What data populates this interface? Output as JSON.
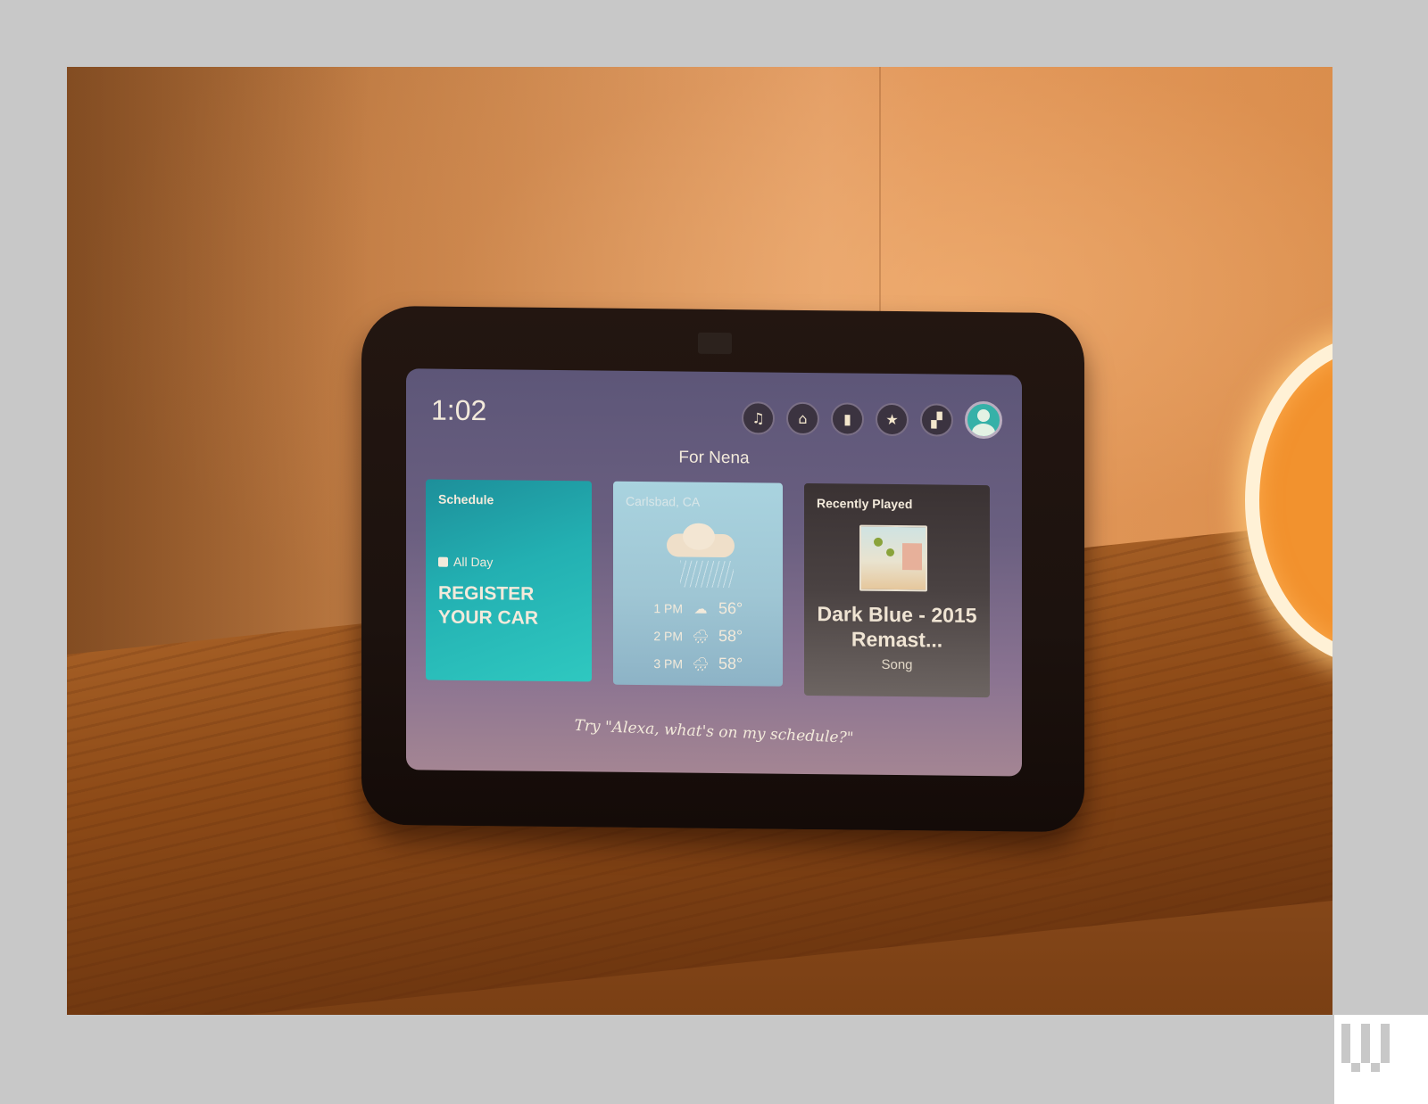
{
  "scene": {
    "description": "Photo of an Amazon Echo Show smart display on a wooden table",
    "colors": {
      "page_background": "#c8c8c8",
      "screen_top": "#5d5678",
      "screen_bottom": "#a48593",
      "schedule_card": "#23b0b2",
      "weather_card": "#a9d3df",
      "music_card": "#3a3233",
      "text_light": "#f3eadb"
    }
  },
  "screen": {
    "clock": "1:02",
    "header_icons": [
      {
        "name": "music-icon",
        "glyph": "♫"
      },
      {
        "name": "smart-home-icon",
        "glyph": "⌂"
      },
      {
        "name": "shopping-bag-icon",
        "glyph": "▮"
      },
      {
        "name": "favorites-star-icon",
        "glyph": "★"
      },
      {
        "name": "add-widget-icon",
        "glyph": "▞"
      }
    ],
    "profile_avatar": "user-avatar",
    "for_label": "For Nena",
    "cards": {
      "schedule": {
        "title": "Schedule",
        "when": "All Day",
        "event": "REGISTER YOUR CAR"
      },
      "weather": {
        "location": "Carlsbad, CA",
        "current_condition": "rain",
        "hourly": [
          {
            "time": "1 PM",
            "icon": "☁",
            "condition": "cloudy",
            "temp": "56°"
          },
          {
            "time": "2 PM",
            "icon": "🌧",
            "condition": "rain",
            "temp": "58°"
          },
          {
            "time": "3 PM",
            "icon": "🌧",
            "condition": "rain",
            "temp": "58°"
          }
        ]
      },
      "recently_played": {
        "title": "Recently Played",
        "track": "Dark Blue - 2015 Remast...",
        "type": "Song"
      }
    },
    "hint": "Try \"Alexa, what's on my schedule?\""
  }
}
